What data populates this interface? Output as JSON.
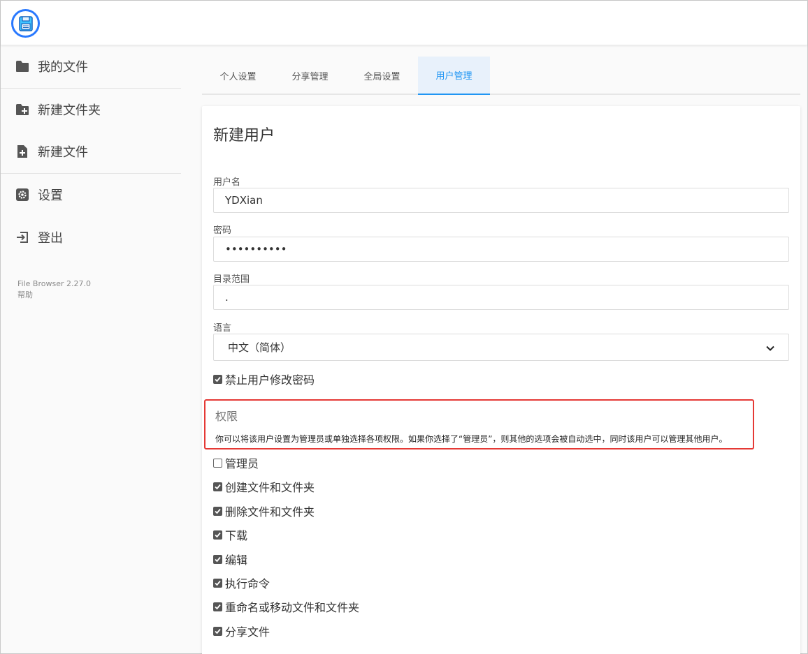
{
  "colors": {
    "accent": "#2196f3",
    "logo_ring": "#2979ff",
    "highlight_border": "#e53935"
  },
  "header": {
    "logo_icon": "floppy-disk-icon"
  },
  "sidebar": {
    "items": [
      {
        "label": "我的文件",
        "icon": "folder-icon"
      },
      {
        "label": "新建文件夹",
        "icon": "folder-plus-icon"
      },
      {
        "label": "新建文件",
        "icon": "file-plus-icon"
      },
      {
        "label": "设置",
        "icon": "gear-icon"
      },
      {
        "label": "登出",
        "icon": "logout-icon"
      }
    ],
    "version": "File Browser 2.27.0",
    "help": "帮助"
  },
  "tabs": [
    {
      "label": "个人设置",
      "active": false
    },
    {
      "label": "分享管理",
      "active": false
    },
    {
      "label": "全局设置",
      "active": false
    },
    {
      "label": "用户管理",
      "active": true
    }
  ],
  "form": {
    "title": "新建用户",
    "username_label": "用户名",
    "username_value": "YDXian",
    "password_label": "密码",
    "password_value": "••••••••••",
    "scope_label": "目录范围",
    "scope_value": ".",
    "language_label": "语言",
    "language_value": "中文（简体）",
    "lock_password": {
      "label": "禁止用户修改密码",
      "checked": true
    }
  },
  "permissions": {
    "title": "权限",
    "description": "你可以将该用户设置为管理员或单独选择各项权限。如果你选择了“管理员”，则其他的选项会被自动选中，同时该用户可以管理其他用户。",
    "items": [
      {
        "label": "管理员",
        "checked": false
      },
      {
        "label": "创建文件和文件夹",
        "checked": true
      },
      {
        "label": "删除文件和文件夹",
        "checked": true
      },
      {
        "label": "下载",
        "checked": true
      },
      {
        "label": "编辑",
        "checked": true
      },
      {
        "label": "执行命令",
        "checked": true
      },
      {
        "label": "重命名或移动文件和文件夹",
        "checked": true
      },
      {
        "label": "分享文件",
        "checked": true
      }
    ]
  }
}
